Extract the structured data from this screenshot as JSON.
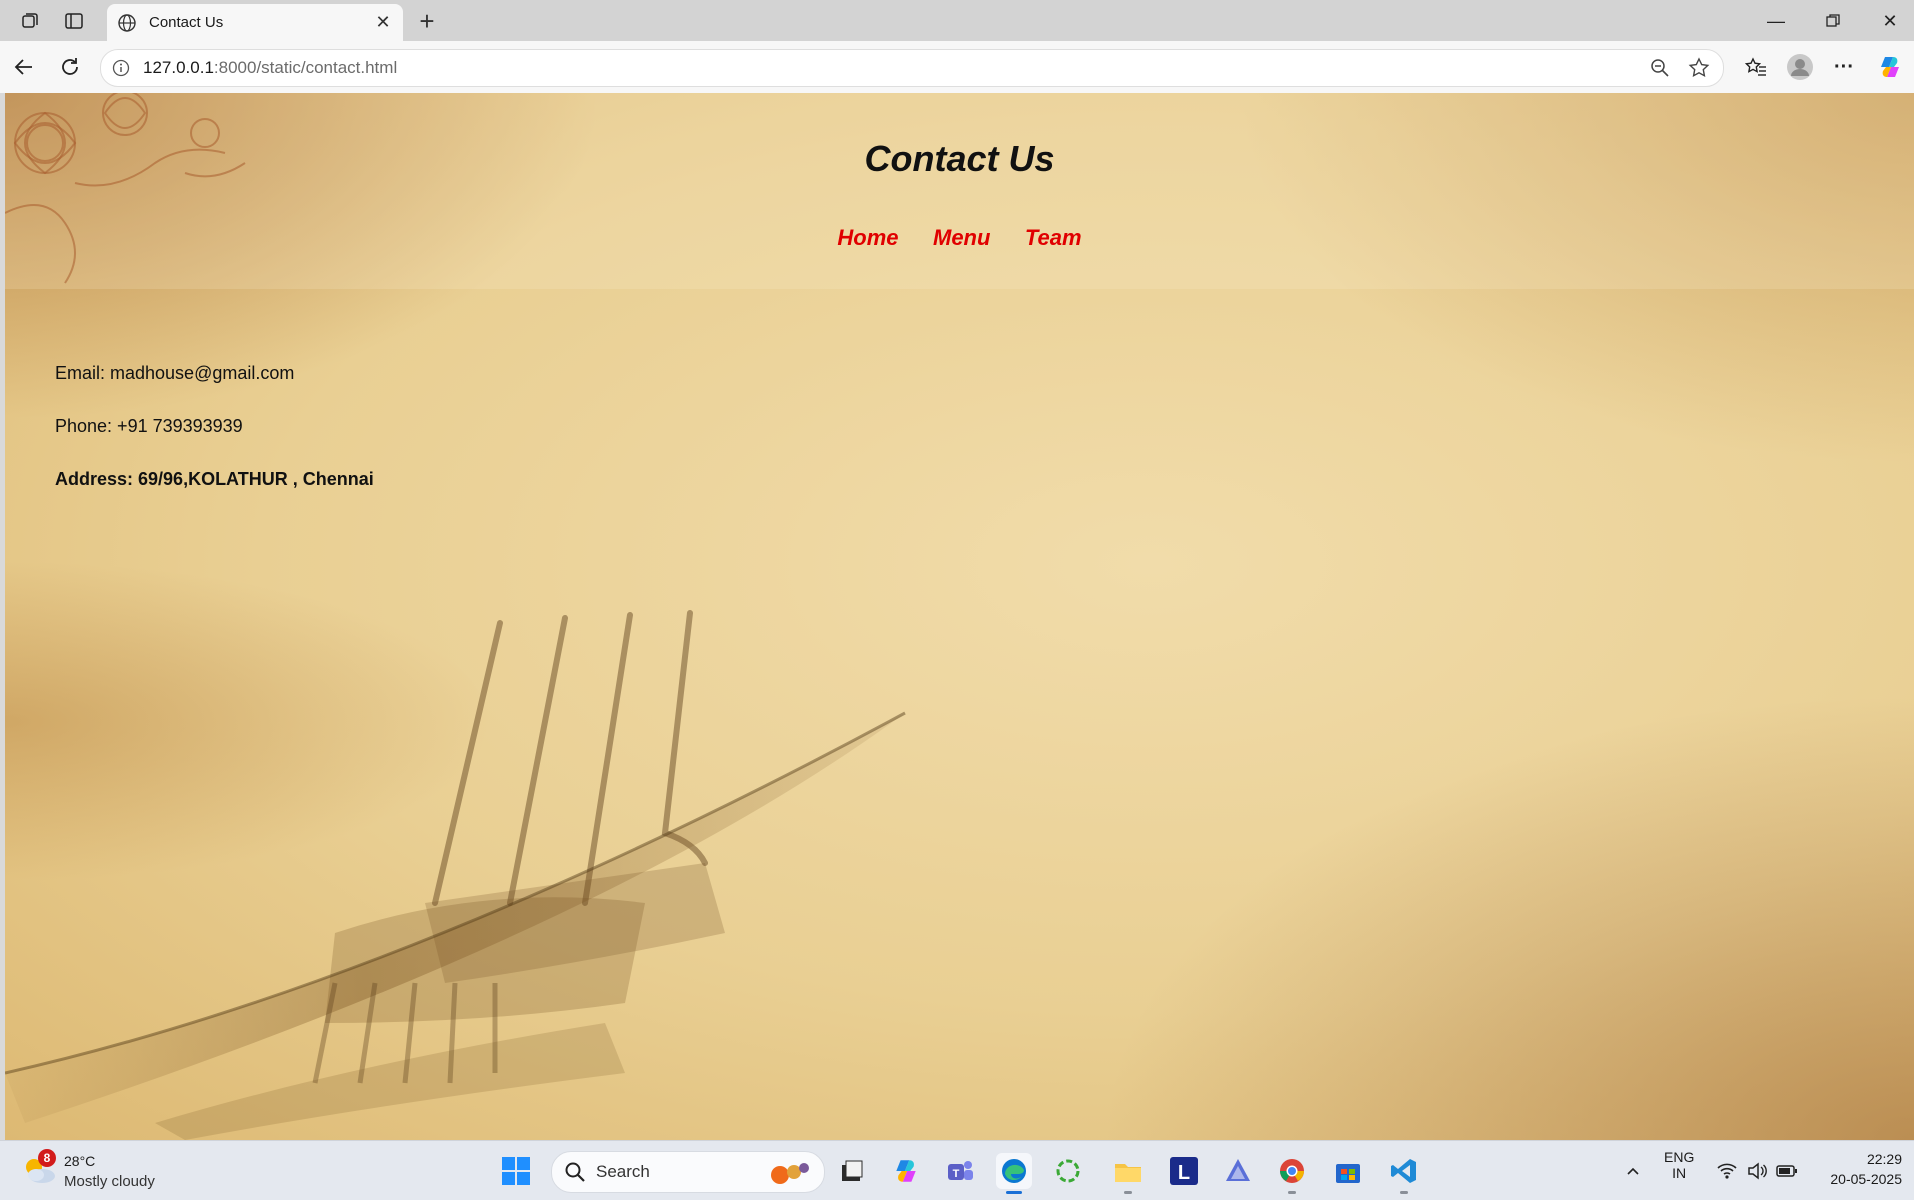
{
  "browser": {
    "tab_title": "Contact Us",
    "url_host": "127.0.0.1",
    "url_rest": ":8000/static/contact.html"
  },
  "page": {
    "title": "Contact Us",
    "nav": [
      "Home",
      "Menu",
      "Team"
    ],
    "email": "Email: madhouse@gmail.com",
    "phone": "Phone: +91 739393939",
    "address": "Address: 69/96,KOLATHUR , Chennai",
    "colors": {
      "title": "#111111",
      "nav_link": "#e00000",
      "background": "#ead094"
    }
  },
  "taskbar": {
    "weather_badge": "8",
    "weather_temp": "28°C",
    "weather_condition": "Mostly cloudy",
    "search_label": "Search",
    "language_top": "ENG",
    "language_bottom": "IN",
    "time": "22:29",
    "date": "20-05-2025",
    "apps": [
      "start-icon",
      "file-browser-icon",
      "copilot-icon",
      "teams-icon",
      "edge-icon",
      "refresh-app-icon",
      "file-explorer-icon",
      "l-app-icon",
      "affinity-icon",
      "chrome-icon",
      "store-icon",
      "vscode-icon"
    ]
  }
}
